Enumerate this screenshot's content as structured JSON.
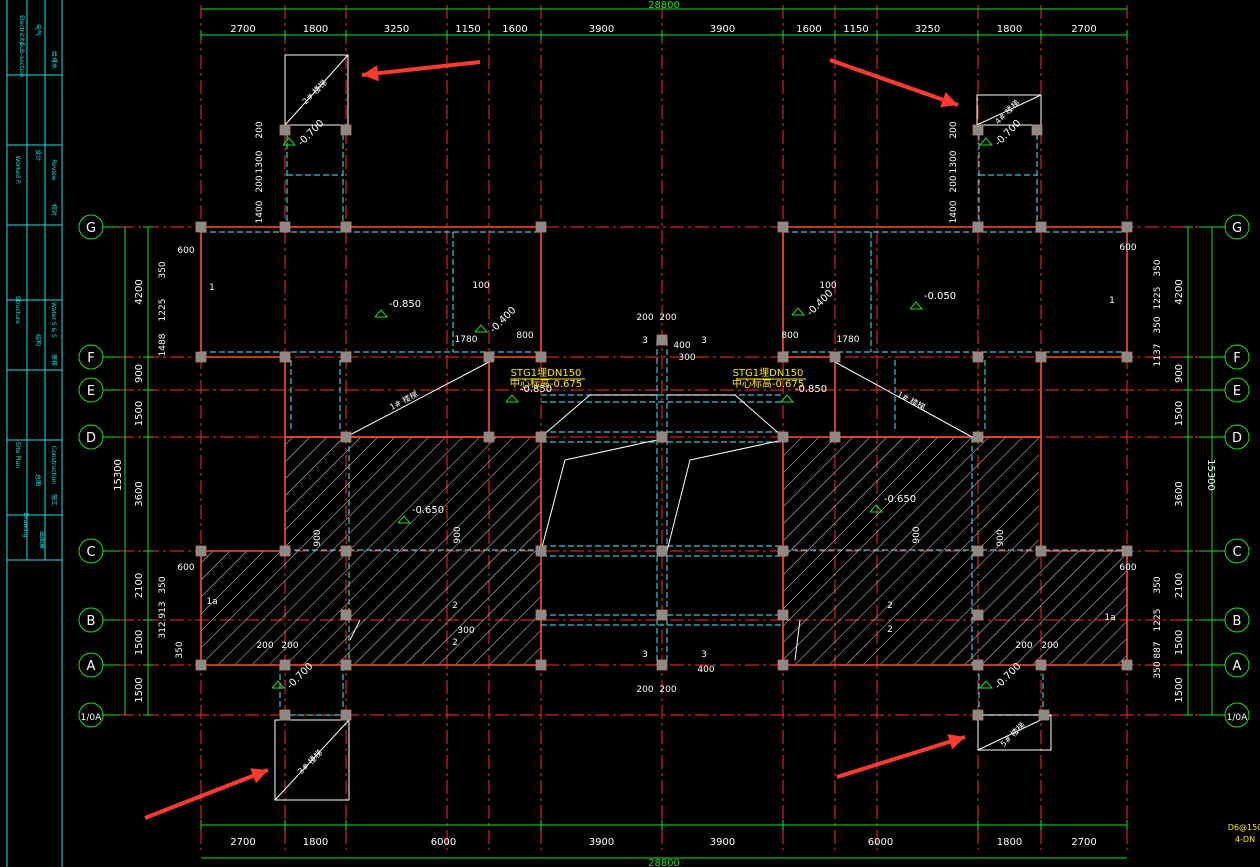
{
  "drawing": {
    "colors": {
      "background": "#000000",
      "axis_line": "#ff2a2a",
      "dimension": "#19e019",
      "beam": "#37c6d8",
      "wall": "#ff4d2e",
      "column": "#8a8a8a",
      "hatch": "#d8d8d8",
      "arrow": "#ff3b30",
      "annotation_yellow": "#ffe600",
      "frame": "#19e0e0"
    },
    "top_total": "28800",
    "bottom_total": "28800",
    "top_dims": [
      "2700",
      "1800",
      "3250",
      "1150",
      "1600",
      "3900",
      "3900",
      "1600",
      "1150",
      "3250",
      "1800",
      "2700"
    ],
    "bottom_dims": [
      "2700",
      "1800",
      "6000",
      "3900",
      "3900",
      "6000",
      "1800",
      "2700"
    ],
    "row_labels": [
      "G",
      "F",
      "E",
      "D",
      "C",
      "B",
      "A",
      "1/0A"
    ],
    "left_dims": [
      "4200",
      "900",
      "1500",
      "3600",
      "2100",
      "1500",
      "1500"
    ],
    "right_dims": [
      "4200",
      "900",
      "1500",
      "3600",
      "2100",
      "1500",
      "1500"
    ],
    "left_total": "15300",
    "right_total": "15300",
    "left_small_dims": [
      "350",
      "1225",
      "1488",
      "350",
      "913",
      "312",
      "350"
    ],
    "right_small_dims": [
      "350",
      "1225",
      "350",
      "1137",
      "350",
      "1225",
      "887",
      "350"
    ],
    "stair_labels": [
      "2# 楼梯",
      "4# 楼梯",
      "3# 楼梯",
      "5# 楼梯",
      "1# 楼梯",
      "1# 楼梯"
    ],
    "levels": [
      "-0.850",
      "-0.050",
      "-0.650",
      "-0.650",
      "-0.700",
      "-0.700",
      "-0.700",
      "-0.700",
      "-0.850",
      "-0.850",
      "-0.400",
      "-0.400"
    ],
    "pipe_notes": [
      "STG1埋DN150",
      "中心标高-0.675",
      "STG1埋DN150",
      "中心标高-0.675"
    ],
    "small_notes": [
      "600",
      "600",
      "600",
      "600",
      "100",
      "100",
      "800",
      "800",
      "1780",
      "1780",
      "200",
      "200",
      "200",
      "200",
      "300",
      "300",
      "400",
      "400",
      "3",
      "3",
      "3",
      "3",
      "1",
      "1",
      "1a",
      "1a",
      "2",
      "2",
      "2",
      "2",
      "1300",
      "1400",
      "1300",
      "1400",
      "200",
      "200",
      "200",
      "200",
      "900",
      "900",
      "900",
      "900",
      "200",
      "200",
      "200",
      "200"
    ],
    "title_block": [
      "Electricity",
      "Sub-section",
      "电气",
      "给排水",
      "Worked P.",
      "Review",
      "设计",
      "校对",
      "Structure",
      "Water S & S",
      "结构",
      "审核",
      "Site Plan",
      "Construction",
      "总图",
      "施工",
      "Drawing",
      "出图章"
    ],
    "corner_note": [
      "D6@150",
      "4-DN"
    ]
  }
}
